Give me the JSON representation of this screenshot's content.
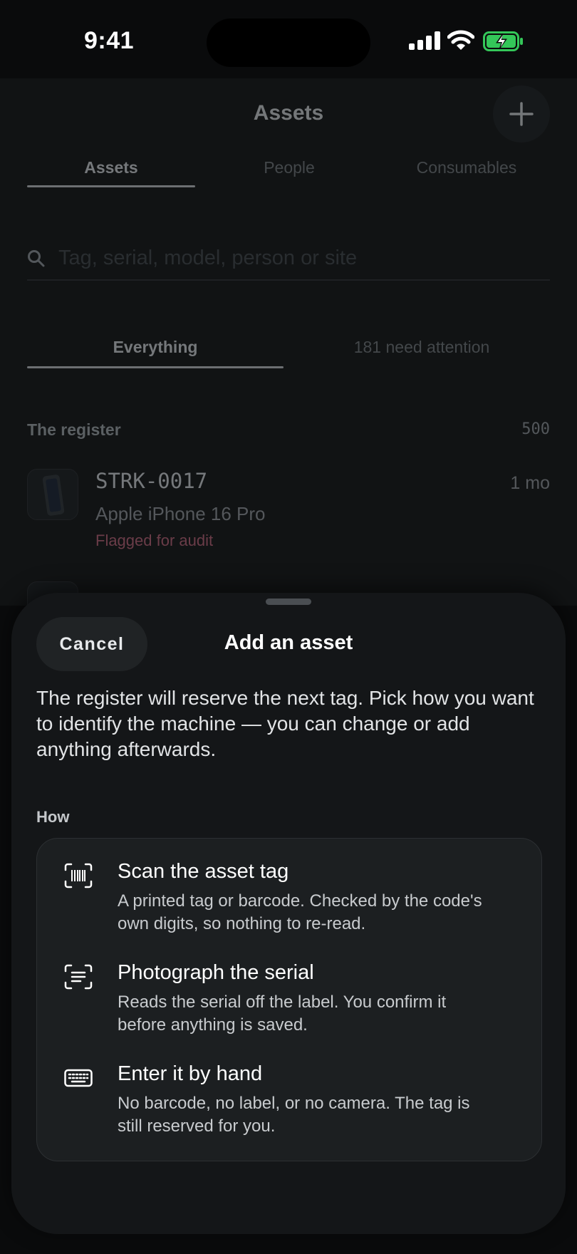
{
  "status_bar": {
    "time": "9:41"
  },
  "background": {
    "nav_title": "Assets",
    "tabs": [
      {
        "label": "Assets",
        "selected": true
      },
      {
        "label": "People",
        "selected": false
      },
      {
        "label": "Consumables",
        "selected": false
      }
    ],
    "search": {
      "placeholder": "Tag, serial, model, person or site"
    },
    "segments": [
      {
        "label": "Everything",
        "selected": true
      },
      {
        "label": "181 need attention",
        "selected": false
      }
    ],
    "section": {
      "title": "The register",
      "count": "500"
    },
    "assets": [
      {
        "tag": "STRK-0017",
        "model": "Apple iPhone 16 Pro",
        "status": "Flagged for audit",
        "age": "1 mo"
      }
    ]
  },
  "sheet": {
    "cancel_label": "Cancel",
    "title": "Add an asset",
    "intro": "The register will reserve the next tag. Pick how you want to identify the machine — you can change or add anything afterwards.",
    "how_label": "How",
    "options": [
      {
        "icon": "barcode-scan-icon",
        "title": "Scan the asset tag",
        "description": "A printed tag or barcode. Checked by the code's own digits, so nothing to re-read."
      },
      {
        "icon": "text-scan-icon",
        "title": "Photograph the serial",
        "description": "Reads the serial off the label. You confirm it before anything is saved."
      },
      {
        "icon": "keyboard-icon",
        "title": "Enter it by hand",
        "description": "No barcode, no label, or no camera. The tag is still reserved for you."
      }
    ]
  },
  "colors": {
    "background": "#0a0b0c",
    "sheet": "#141618",
    "flag": "#b45f74",
    "battery": "#34c759"
  }
}
